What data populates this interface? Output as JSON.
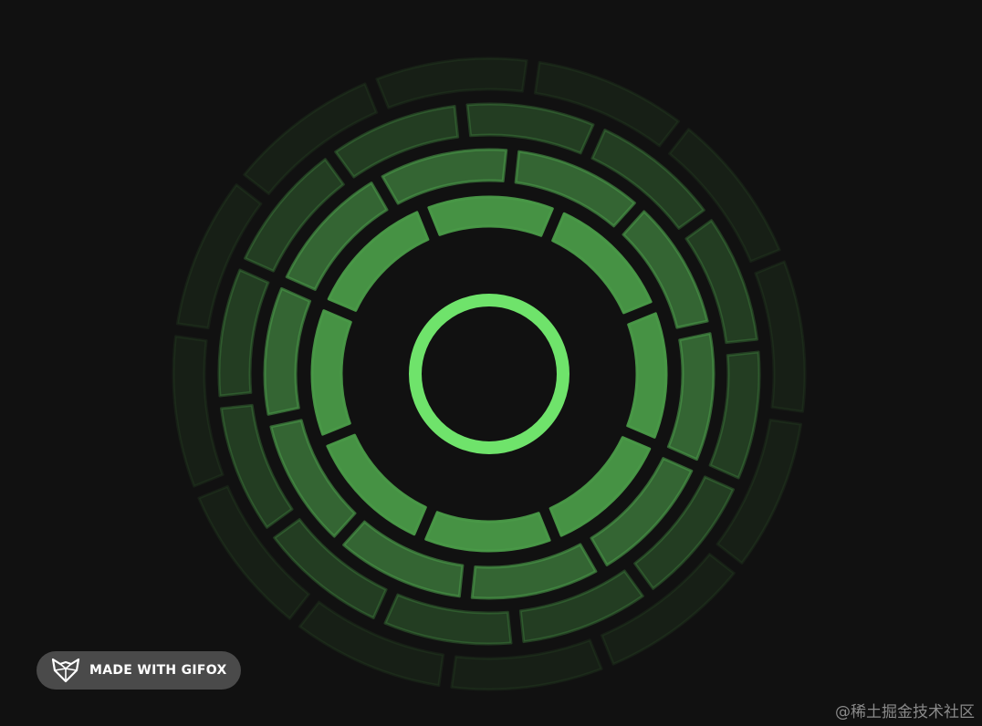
{
  "badge": {
    "label": "MADE WITH GIFOX",
    "icon": "fox-logo-icon"
  },
  "watermark": {
    "text": "@稀土掘金技术社区"
  },
  "colors": {
    "background": "#111111",
    "core_ring": "#6fe36b",
    "segment_green": "#4a9a48",
    "badge_bg": "#4a4a4a",
    "badge_text": "#ffffff",
    "watermark_text": "#8a8a8a"
  }
}
